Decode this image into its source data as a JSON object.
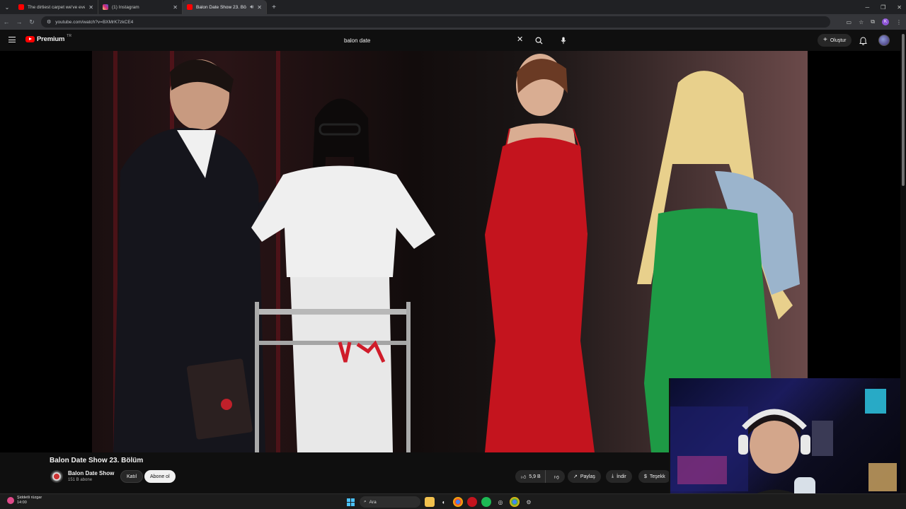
{
  "browser": {
    "tabs": [
      {
        "title": "The dirtiest carpet we've ever c",
        "favicon_color": "#ff0000",
        "active": false
      },
      {
        "title": "(1) Instagram",
        "favicon_color": "#d62976",
        "active": false
      },
      {
        "title": "Balon Date Show 23. Bölüm",
        "favicon_color": "#ff0000",
        "active": true
      }
    ],
    "url": "youtube.com/watch?v=BXMrK7zkCE4"
  },
  "yt": {
    "brand": "Premium",
    "region": "TR",
    "search_value": "balon date",
    "create_label": "Oluştur"
  },
  "video": {
    "title": "Balon Date Show 23. Bölüm",
    "channel": "Balon Date Show",
    "subscribers": "151 B abone",
    "join_label": "Katıl",
    "subscribe_label": "Abone ol",
    "likes": "5,9 B",
    "share_label": "Paylaş",
    "download_label": "İndir",
    "thanks_label": "Teşekk"
  },
  "taskbar": {
    "weather_desc": "Şiddetli rüzgar",
    "weather_value": "14:00",
    "search_placeholder": "Ara"
  },
  "colors": {
    "yt_red": "#ff0000",
    "background": "#0f0f0f",
    "pill": "#272727"
  }
}
